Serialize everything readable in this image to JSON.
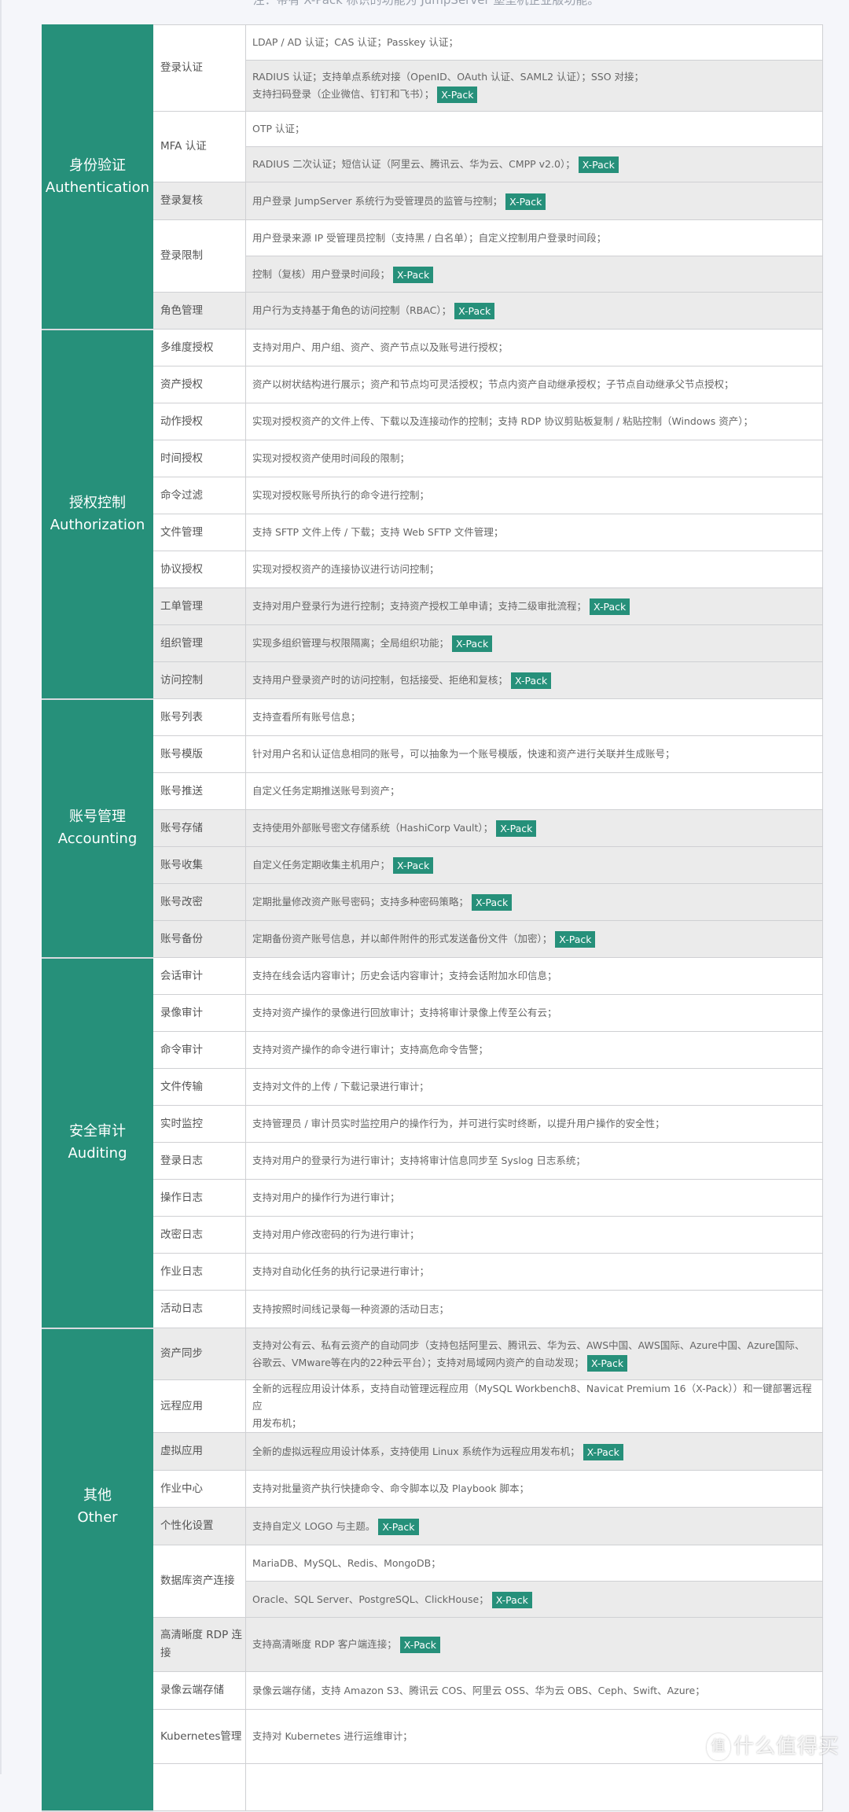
{
  "note": "注：带有 X-Pack 标识的功能为 JumpServer 堡垒机企业版功能。",
  "badge_label": "X-Pack",
  "colors": {
    "accent": "#26907a",
    "row_gray": "#ebebeb",
    "page_bg": "#f5f6fa"
  },
  "watermark": {
    "icon": "值",
    "text": "什么值得买"
  },
  "categories": [
    {
      "zh": "身份验证",
      "en": "Authentication",
      "features": [
        {
          "name": "登录认证",
          "rows": [
            {
              "text": "LDAP / AD 认证；CAS 认证；Passkey 认证；",
              "xpack": false,
              "bg": "white",
              "h": 45
            },
            {
              "text": "RADIUS 认证；支持单点系统对接（OpenID、OAuth 认证、SAML2 认证）；SSO 对接；",
              "text2": "支持扫码登录（企业微信、钉钉和飞书）；",
              "xpack": true,
              "bg": "gray",
              "h": 65
            }
          ]
        },
        {
          "name": "MFA 认证",
          "rows": [
            {
              "text": "OTP 认证；",
              "xpack": false,
              "bg": "white",
              "h": 45
            },
            {
              "text": "RADIUS 二次认证；短信认证（阿里云、腾讯云、华为云、CMPP v2.0）；",
              "xpack": true,
              "bg": "gray",
              "h": 45
            }
          ]
        },
        {
          "name": "登录复核",
          "bg": "gray",
          "rows": [
            {
              "text": "用户登录 JumpServer 系统行为受管理员的监管与控制；",
              "xpack": true,
              "bg": "gray",
              "h": 48
            }
          ]
        },
        {
          "name": "登录限制",
          "rows": [
            {
              "text": "用户登录来源 IP 受管理员控制（支持黑 / 白名单）；自定义控制用户登录时间段；",
              "xpack": false,
              "bg": "white",
              "h": 46
            },
            {
              "text": "控制（复核）用户登录时间段；",
              "xpack": true,
              "bg": "gray",
              "h": 46
            }
          ]
        },
        {
          "name": "角色管理",
          "bg": "gray",
          "rows": [
            {
              "text": "用户行为支持基于角色的访问控制（RBAC）；",
              "xpack": true,
              "bg": "gray",
              "h": 47
            }
          ]
        }
      ]
    },
    {
      "zh": "授权控制",
      "en": "Authorization",
      "features": [
        {
          "name": "多维度授权",
          "rows": [
            {
              "text": "支持对用户、用户组、资产、资产节点以及账号进行授权；",
              "xpack": false,
              "bg": "white",
              "h": 47
            }
          ]
        },
        {
          "name": "资产授权",
          "rows": [
            {
              "text": "资产以树状结构进行展示；资产和节点均可灵活授权；节点内资产自动继承授权；子节点自动继承父节点授权；",
              "xpack": false,
              "bg": "white",
              "h": 47
            }
          ]
        },
        {
          "name": "动作授权",
          "rows": [
            {
              "text": "实现对授权资产的文件上传、下载以及连接动作的控制；支持 RDP 协议剪贴板复制 / 粘贴控制（Windows 资产）；",
              "xpack": false,
              "bg": "white",
              "h": 47
            }
          ]
        },
        {
          "name": "时间授权",
          "rows": [
            {
              "text": "实现对授权资产使用时间段的限制；",
              "xpack": false,
              "bg": "white",
              "h": 47
            }
          ]
        },
        {
          "name": "命令过滤",
          "rows": [
            {
              "text": "实现对授权账号所执行的命令进行控制；",
              "xpack": false,
              "bg": "white",
              "h": 47
            }
          ]
        },
        {
          "name": "文件管理",
          "rows": [
            {
              "text": "支持 SFTP 文件上传 / 下载；支持 Web SFTP 文件管理；",
              "xpack": false,
              "bg": "white",
              "h": 47
            }
          ]
        },
        {
          "name": "协议授权",
          "rows": [
            {
              "text": "实现对授权资产的连接协议进行访问控制；",
              "xpack": false,
              "bg": "white",
              "h": 47
            }
          ]
        },
        {
          "name": "工单管理",
          "bg": "gray",
          "rows": [
            {
              "text": "支持对用户登录行为进行控制；支持资产授权工单申请；支持二级审批流程；",
              "xpack": true,
              "bg": "gray",
              "h": 47
            }
          ]
        },
        {
          "name": "组织管理",
          "bg": "gray",
          "rows": [
            {
              "text": "实现多组织管理与权限隔离；全局组织功能；",
              "xpack": true,
              "bg": "gray",
              "h": 47
            }
          ]
        },
        {
          "name": "访问控制",
          "bg": "gray",
          "rows": [
            {
              "text": "支持用户登录资产时的访问控制，包括接受、拒绝和复核；",
              "xpack": true,
              "bg": "gray",
              "h": 47
            }
          ]
        }
      ]
    },
    {
      "zh": "账号管理",
      "en": "Accounting",
      "features": [
        {
          "name": "账号列表",
          "rows": [
            {
              "text": "支持查看所有账号信息；",
              "xpack": false,
              "bg": "white",
              "h": 47
            }
          ]
        },
        {
          "name": "账号模版",
          "rows": [
            {
              "text": "针对用户名和认证信息相同的账号，可以抽象为一个账号模版，快速和资产进行关联并生成账号；",
              "xpack": false,
              "bg": "white",
              "h": 47
            }
          ]
        },
        {
          "name": "账号推送",
          "rows": [
            {
              "text": "自定义任务定期推送账号到资产；",
              "xpack": false,
              "bg": "white",
              "h": 47
            }
          ]
        },
        {
          "name": "账号存储",
          "bg": "gray",
          "rows": [
            {
              "text": "支持使用外部账号密文存储系统（HashiCorp Vault）；",
              "xpack": true,
              "bg": "gray",
              "h": 47
            }
          ]
        },
        {
          "name": "账号收集",
          "bg": "gray",
          "rows": [
            {
              "text": "自定义任务定期收集主机用户；",
              "xpack": true,
              "bg": "gray",
              "h": 47
            }
          ]
        },
        {
          "name": "账号改密",
          "bg": "gray",
          "rows": [
            {
              "text": "定期批量修改资产账号密码；支持多种密码策略；",
              "xpack": true,
              "bg": "gray",
              "h": 47
            }
          ]
        },
        {
          "name": "账号备份",
          "bg": "gray",
          "rows": [
            {
              "text": "定期备份资产账号信息，并以邮件附件的形式发送备份文件（加密）；",
              "xpack": true,
              "bg": "gray",
              "h": 47
            }
          ]
        }
      ]
    },
    {
      "zh": "安全审计",
      "en": "Auditing",
      "features": [
        {
          "name": "会话审计",
          "rows": [
            {
              "text": "支持在线会话内容审计；历史会话内容审计；支持会话附加水印信息；",
              "xpack": false,
              "bg": "white",
              "h": 47
            }
          ]
        },
        {
          "name": "录像审计",
          "rows": [
            {
              "text": "支持对资产操作的录像进行回放审计；支持将审计录像上传至公有云；",
              "xpack": false,
              "bg": "white",
              "h": 47
            }
          ]
        },
        {
          "name": "命令审计",
          "rows": [
            {
              "text": "支持对资产操作的命令进行审计；支持高危命令告警；",
              "xpack": false,
              "bg": "white",
              "h": 47
            }
          ]
        },
        {
          "name": "文件传输",
          "rows": [
            {
              "text": "支持对文件的上传 / 下载记录进行审计；",
              "xpack": false,
              "bg": "white",
              "h": 47
            }
          ]
        },
        {
          "name": "实时监控",
          "rows": [
            {
              "text": "支持管理员 / 审计员实时监控用户的操作行为，并可进行实时终断，以提升用户操作的安全性；",
              "xpack": false,
              "bg": "white",
              "h": 47
            }
          ]
        },
        {
          "name": "登录日志",
          "rows": [
            {
              "text": "支持对用户的登录行为进行审计；支持将审计信息同步至 Syslog 日志系统；",
              "xpack": false,
              "bg": "white",
              "h": 47
            }
          ]
        },
        {
          "name": "操作日志",
          "rows": [
            {
              "text": "支持对用户的操作行为进行审计；",
              "xpack": false,
              "bg": "white",
              "h": 47
            }
          ]
        },
        {
          "name": "改密日志",
          "rows": [
            {
              "text": "支持对用户修改密码的行为进行审计；",
              "xpack": false,
              "bg": "white",
              "h": 47
            }
          ]
        },
        {
          "name": "作业日志",
          "rows": [
            {
              "text": "支持对自动化任务的执行记录进行审计；",
              "xpack": false,
              "bg": "white",
              "h": 47
            }
          ]
        },
        {
          "name": "活动日志",
          "rows": [
            {
              "text": "支持按照时间线记录每一种资源的活动日志；",
              "xpack": false,
              "bg": "white",
              "h": 48
            }
          ]
        }
      ]
    },
    {
      "zh": "其他",
      "en": "Other",
      "features": [
        {
          "name": "资产同步",
          "bg": "gray",
          "rows": [
            {
              "text": "支持对公有云、私有云资产的自动同步（支持包括阿里云、腾讯云、华为云、AWS中国、AWS国际、Azure中国、Azure国际、",
              "text2": "谷歌云、VMware等在内的22种云平台）；支持对局域网内资产的自动发现；",
              "xpack": true,
              "bg": "gray",
              "h": 66
            }
          ]
        },
        {
          "name": "远程应用",
          "rows": [
            {
              "text": "全新的远程应用设计体系，支持自动管理远程应用（MySQL Workbench8、Navicat Premium 16（X-Pack））和一键部署远程应",
              "text2": "用发布机；",
              "xpack": false,
              "bg": "white",
              "h": 63
            }
          ]
        },
        {
          "name": "虚拟应用",
          "bg": "gray",
          "rows": [
            {
              "text": "全新的虚拟远程应用设计体系，支持使用 Linux 系统作为远程应用发布机；",
              "xpack": true,
              "bg": "gray",
              "h": 48
            }
          ]
        },
        {
          "name": "作业中心",
          "rows": [
            {
              "text": "支持对批量资产执行快捷命令、命令脚本以及 Playbook 脚本；",
              "xpack": false,
              "bg": "white",
              "h": 47
            }
          ]
        },
        {
          "name": "个性化设置",
          "bg": "gray",
          "rows": [
            {
              "text": "支持自定义 LOGO 与主题。",
              "xpack": true,
              "bg": "gray",
              "h": 48
            }
          ]
        },
        {
          "name": "数据库资产连接",
          "rows": [
            {
              "text": "MariaDB、MySQL、Redis、MongoDB；",
              "xpack": false,
              "bg": "white",
              "h": 46
            },
            {
              "text": "Oracle、SQL Server、PostgreSQL、ClickHouse；",
              "xpack": true,
              "bg": "gray",
              "h": 46
            }
          ]
        },
        {
          "name": "高清晰度 RDP 连接",
          "bg": "gray",
          "rows": [
            {
              "text": "支持高清晰度 RDP 客户端连接；",
              "xpack": true,
              "bg": "gray",
              "h": 69
            }
          ]
        },
        {
          "name": "录像云端存储",
          "rows": [
            {
              "text": "录像云端存储，支持 Amazon S3、腾讯云 COS、阿里云 OSS、华为云 OBS、Ceph、Swift、Azure；",
              "xpack": false,
              "bg": "white",
              "h": 48
            }
          ]
        },
        {
          "name": "Kubernetes管理",
          "rows": [
            {
              "text": "支持对 Kubernetes 进行运维审计；",
              "xpack": false,
              "bg": "white",
              "h": 69
            }
          ]
        },
        {
          "name": "",
          "rows": [
            {
              "text": "",
              "xpack": false,
              "bg": "white",
              "h": 60
            }
          ]
        }
      ]
    }
  ]
}
